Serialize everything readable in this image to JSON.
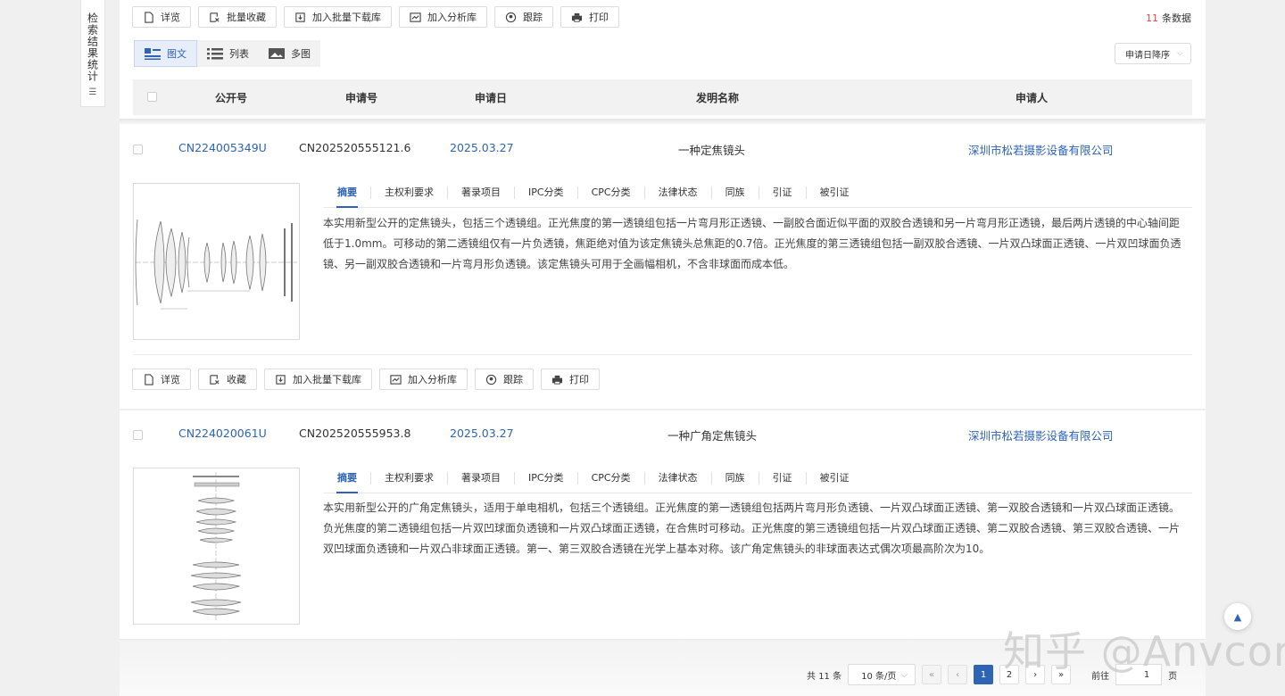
{
  "sidebar_tab": {
    "label": "检索结果统计"
  },
  "toolbar": {
    "buttons": [
      "详览",
      "批量收藏",
      "加入批量下载库",
      "加入分析库",
      "跟踪",
      "打印"
    ],
    "count_num": "11",
    "count_suffix": "条数据"
  },
  "view_tabs": [
    "图文",
    "列表",
    "多图"
  ],
  "sort": {
    "selected": "申请日降序"
  },
  "table_headers": [
    "公开号",
    "申请号",
    "申请日",
    "发明名称",
    "申请人"
  ],
  "detail_tabs": [
    "摘要",
    "主权利要求",
    "著录项目",
    "IPC分类",
    "CPC分类",
    "法律状态",
    "同族",
    "引证",
    "被引证"
  ],
  "record_buttons": [
    "详览",
    "收藏",
    "加入批量下载库",
    "加入分析库",
    "跟踪",
    "打印"
  ],
  "records": [
    {
      "pub_no": "CN224005349U",
      "app_no": "CN202520555121.6",
      "app_date": "2025.03.27",
      "title": "一种定焦镜头",
      "applicant": "深圳市松若摄影设备有限公司",
      "abstract": "本实用新型公开的定焦镜头，包括三个透镜组。正光焦度的第一透镜组包括一片弯月形正透镜、一副胶合面近似平面的双胶合透镜和另一片弯月形正透镜，最后两片透镜的中心轴间距低于1.0mm。可移动的第二透镜组仅有一片负透镜，焦距绝对值为该定焦镜头总焦距的0.7倍。正光焦度的第三透镜组包括一副双胶合透镜、一片双凸球面正透镜、一片双凹球面负透镜、另一副双胶合透镜和一片弯月形负透镜。该定焦镜头可用于全画幅相机，不含非球面而成本低。"
    },
    {
      "pub_no": "CN224020061U",
      "app_no": "CN202520555953.8",
      "app_date": "2025.03.27",
      "title": "一种广角定焦镜头",
      "applicant": "深圳市松若摄影设备有限公司",
      "abstract": "本实用新型公开的广角定焦镜头，适用于单电相机，包括三个透镜组。正光焦度的第一透镜组包括两片弯月形负透镜、一片双凸球面正透镜、第一双胶合透镜和一片双凸球面正透镜。负光焦度的第二透镜组包括一片双凹球面负透镜和一片双凸球面正透镜，在合焦时可移动。正光焦度的第三透镜组包括一片双凸球面正透镜、第二双胶合透镜、第三双胶合透镜、一片双凹球面负透镜和一片双凸非球面正透镜。第一、第三双胶合透镜在光学上基本对称。该广角定焦镜头的非球面表达式偶次项最高阶次为10。"
    }
  ],
  "pagination": {
    "total_prefix": "共",
    "total": "11",
    "total_suffix": "条",
    "page_size": "10 条/页",
    "pages": [
      "1",
      "2"
    ],
    "goto_label": "前往",
    "goto_value": "1",
    "goto_suffix": "页"
  },
  "watermark": "知乎 @Anvcor",
  "colors": {
    "accent": "#2d64b3",
    "count": "#e04646"
  }
}
